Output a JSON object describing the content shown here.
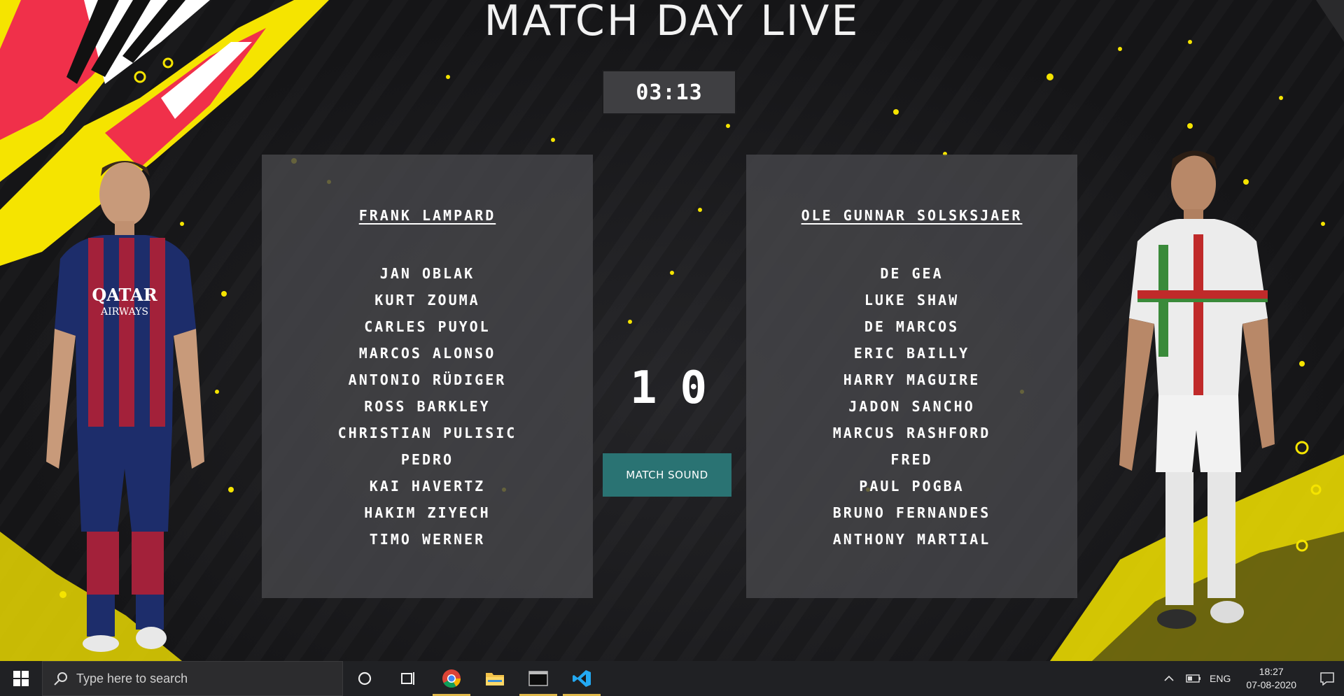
{
  "app": {
    "title": "MATCH DAY LIVE",
    "timer": "03:13",
    "score_home": "1",
    "score_away": "0",
    "sound_button": "MATCH SOUND"
  },
  "home": {
    "coach": "FRANK LAMPARD",
    "players": [
      "JAN OBLAK",
      "KURT ZOUMA",
      "CARLES PUYOL",
      "MARCOS ALONSO",
      "ANTONIO RÜDIGER",
      "ROSS BARKLEY",
      "CHRISTIAN PULISIC",
      "PEDRO",
      "KAI HAVERTZ",
      "HAKIM ZIYECH",
      "TIMO WERNER"
    ]
  },
  "away": {
    "coach": "OLE GUNNAR SOLSKSJAER",
    "players": [
      "DE GEA",
      "LUKE SHAW",
      "DE MARCOS",
      "ERIC BAILLY",
      "HARRY MAGUIRE",
      "JADON SANCHO",
      "MARCUS RASHFORD",
      "FRED",
      "PAUL POGBA",
      "BRUNO FERNANDES",
      "ANTHONY MARTIAL"
    ]
  },
  "figures": {
    "left_shirt_text_1": "QATAR",
    "left_shirt_text_2": "AIRWAYS"
  },
  "taskbar": {
    "search_placeholder": "Type here to search",
    "language": "ENG",
    "time": "18:27",
    "date": "07-08-2020",
    "pinned": [
      "chrome-icon",
      "file-explorer-icon",
      "terminal-icon",
      "vscode-icon"
    ]
  },
  "colors": {
    "accent_yellow": "#f5e400",
    "accent_red": "#f0304a",
    "button_teal": "#2a7373",
    "panel": "#464649"
  }
}
